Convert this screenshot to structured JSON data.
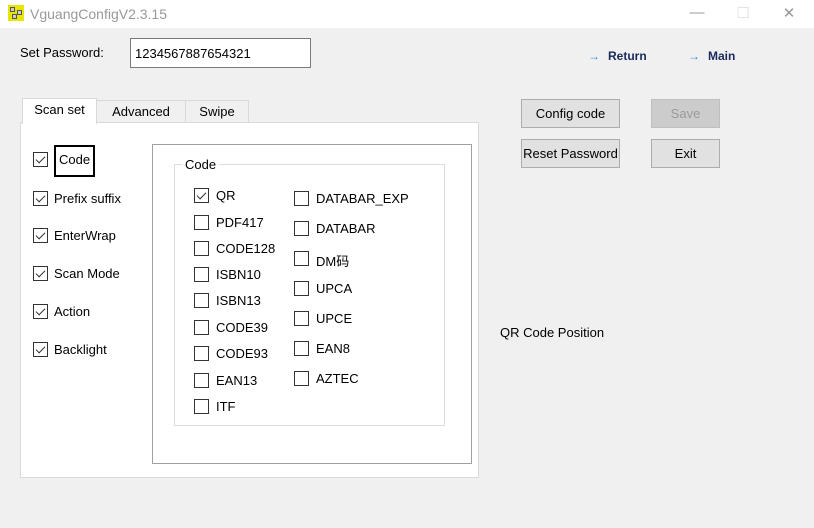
{
  "window": {
    "title": "VguangConfigV2.3.15",
    "minimize": "—",
    "maximize": "☐",
    "close": "✕"
  },
  "password": {
    "label": "Set Password:",
    "value": "1234567887654321"
  },
  "links": [
    {
      "label": "Return",
      "icon": "→"
    },
    {
      "label": "Main",
      "icon": "→"
    }
  ],
  "buttons": {
    "config_code": "Config code",
    "save": "Save",
    "reset_password": "Reset Password",
    "exit": "Exit"
  },
  "tabs": [
    {
      "label": "Scan set",
      "active": true
    },
    {
      "label": "Advanced",
      "active": false
    },
    {
      "label": "Swipe",
      "active": false
    }
  ],
  "scan_options": [
    {
      "label": "Code",
      "checked": true
    },
    {
      "label": "Prefix suffix",
      "checked": true
    },
    {
      "label": "EnterWrap",
      "checked": true
    },
    {
      "label": "Scan Mode",
      "checked": true
    },
    {
      "label": "Action",
      "checked": true
    },
    {
      "label": "Backlight",
      "checked": true
    }
  ],
  "code_group": {
    "title": "Code",
    "col1": [
      {
        "label": "QR",
        "checked": true
      },
      {
        "label": "PDF417",
        "checked": false
      },
      {
        "label": "CODE128",
        "checked": false
      },
      {
        "label": "ISBN10",
        "checked": false
      },
      {
        "label": "ISBN13",
        "checked": false
      },
      {
        "label": "CODE39",
        "checked": false
      },
      {
        "label": "CODE93",
        "checked": false
      },
      {
        "label": "EAN13",
        "checked": false
      },
      {
        "label": "ITF",
        "checked": false
      }
    ],
    "col2": [
      {
        "label": "DATABAR_EXP",
        "checked": false
      },
      {
        "label": "DATABAR",
        "checked": false
      },
      {
        "label": "DM码",
        "checked": false
      },
      {
        "label": "UPCA",
        "checked": false
      },
      {
        "label": "UPCE",
        "checked": false
      },
      {
        "label": "EAN8",
        "checked": false
      },
      {
        "label": "AZTEC",
        "checked": false
      }
    ]
  },
  "qr_position_label": "QR Code Position"
}
